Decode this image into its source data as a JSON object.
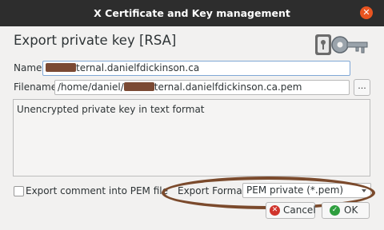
{
  "window": {
    "title": "X Certificate and Key management",
    "close_icon": "close-icon"
  },
  "header": {
    "heading": "Export private key [RSA]",
    "icon": "key-icon"
  },
  "form": {
    "name_label": "Name",
    "name_value_suffix": "ternal.danielfdickinson.ca",
    "filename_label": "Filename",
    "filename_prefix": "/home/daniel/",
    "filename_suffix": "ternal.danielfdickinson.ca.pem",
    "browse_label": "...",
    "description": "Unencrypted private key in text format",
    "export_comment_label": "Export comment into PEM file",
    "export_comment_checked": false,
    "export_format_label": "Export Format",
    "export_format_value": "PEM private (*.pem)"
  },
  "buttons": {
    "cancel_label": "Cancel",
    "ok_label": "OK"
  },
  "colors": {
    "titlebar": "#2d2d2d",
    "close": "#e95420",
    "annotation": "#7b4a2c"
  }
}
